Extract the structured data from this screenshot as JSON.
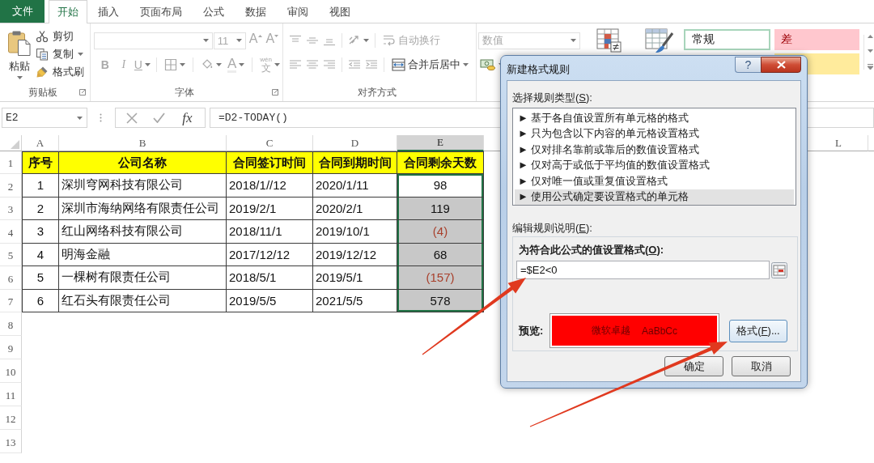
{
  "ribbon_tabs": [
    {
      "label": "文件",
      "kind": "file",
      "selected": false
    },
    {
      "label": "开始",
      "kind": "tab",
      "selected": true
    },
    {
      "label": "插入",
      "kind": "tab",
      "selected": false
    },
    {
      "label": "页面布局",
      "kind": "tab",
      "selected": false
    },
    {
      "label": "公式",
      "kind": "tab",
      "selected": false
    },
    {
      "label": "数据",
      "kind": "tab",
      "selected": false
    },
    {
      "label": "审阅",
      "kind": "tab",
      "selected": false
    },
    {
      "label": "视图",
      "kind": "tab",
      "selected": false
    }
  ],
  "clipboard_group": {
    "label": "剪贴板",
    "paste": "粘贴",
    "commands": [
      {
        "kind": "cut",
        "label": "剪切",
        "dropdown": false
      },
      {
        "kind": "copy",
        "label": "复制",
        "dropdown": true
      },
      {
        "kind": "painter",
        "label": "格式刷",
        "dropdown": false
      }
    ]
  },
  "font_group": {
    "label": "字体",
    "disabled": true,
    "font_size": "11",
    "size_buttons": [
      {
        "kind": "grow",
        "label": "A"
      },
      {
        "kind": "shrink",
        "label": "A"
      }
    ],
    "style_buttons": [
      {
        "kind": "bold",
        "label": "B"
      },
      {
        "kind": "italic",
        "label": "I"
      },
      {
        "kind": "underline",
        "label": "U"
      }
    ],
    "font_color": "A",
    "phonetic": {
      "label": "文",
      "ruby": "wén"
    }
  },
  "alignment_group": {
    "label": "对齐方式",
    "disabled": true,
    "wrap_text": {
      "label": "自动换行",
      "disabled": true
    },
    "merge_center": {
      "label": "合并后居中",
      "disabled": false
    }
  },
  "number_group": {
    "format": "数值",
    "disabled": true
  },
  "cell_styles": [
    {
      "kind": "normal",
      "label": "常规"
    },
    {
      "kind": "bad",
      "label": "差"
    },
    {
      "kind": "neutral"
    }
  ],
  "formula_bar": {
    "name_box": "E2",
    "function_button": "fx",
    "formula": "=D2-TODAY()"
  },
  "sheet": {
    "columns": [
      {
        "label": "A",
        "selected": false
      },
      {
        "label": "B",
        "selected": false
      },
      {
        "label": "C",
        "selected": false
      },
      {
        "label": "D",
        "selected": false
      },
      {
        "label": "E",
        "selected": true
      }
    ],
    "far_columns": [
      {
        "label": "L",
        "selected": false
      }
    ],
    "row_numbers": [
      "1",
      "2",
      "3",
      "4",
      "5",
      "6",
      "7",
      "8",
      "9",
      "10",
      "11",
      "12",
      "13"
    ],
    "header": [
      "序号",
      "公司名称",
      "合同签订时间",
      "合同到期时间",
      "合同剩余天数"
    ],
    "rows": [
      {
        "cells": [
          "1",
          "深圳穹网科技有限公司",
          "2018/1//12",
          "2020/1/11"
        ],
        "remaining": {
          "text": "98",
          "selected": true,
          "active": true,
          "negative": false
        }
      },
      {
        "cells": [
          "2",
          "深圳市海纳网络有限责任公司",
          "2019/2/1",
          "2020/2/1"
        ],
        "remaining": {
          "text": "119",
          "selected": true,
          "active": false,
          "negative": false
        }
      },
      {
        "cells": [
          "3",
          "红山网络科技有限公司",
          "2018/11/1",
          "2019/10/1"
        ],
        "remaining": {
          "text": "(4)",
          "selected": true,
          "active": false,
          "negative": true
        }
      },
      {
        "cells": [
          "4",
          "明海金融",
          "2017/12/12",
          "2019/12/12"
        ],
        "remaining": {
          "text": "68",
          "selected": true,
          "active": false,
          "negative": false
        }
      },
      {
        "cells": [
          "5",
          "一棵树有限责任公司",
          "2018/5/1",
          "2019/5/1"
        ],
        "remaining": {
          "text": "(157)",
          "selected": true,
          "active": false,
          "negative": true
        }
      },
      {
        "cells": [
          "6",
          "红石头有限责任公司",
          "2019/5/5",
          "2021/5/5"
        ],
        "remaining": {
          "text": "578",
          "selected": true,
          "active": false,
          "negative": false
        }
      }
    ]
  },
  "dialog": {
    "title": "新建格式规则",
    "help_button": "?",
    "rule_type_label": {
      "before": "选择规则类型(",
      "key": "S",
      "after": "):"
    },
    "rule_types": [
      {
        "label": "► 基于各自值设置所有单元格的格式",
        "selected": false
      },
      {
        "label": "► 只为包含以下内容的单元格设置格式",
        "selected": false
      },
      {
        "label": "► 仅对排名靠前或靠后的数值设置格式",
        "selected": false
      },
      {
        "label": "► 仅对高于或低于平均值的数值设置格式",
        "selected": false
      },
      {
        "label": "► 仅对唯一值或重复值设置格式",
        "selected": false
      },
      {
        "label": "► 使用公式确定要设置格式的单元格",
        "selected": true
      }
    ],
    "description_label": {
      "before": "编辑规则说明(",
      "key": "E",
      "after": "):"
    },
    "formula_label": {
      "before": "为符合此公式的值设置格式(",
      "key": "O",
      "after": "):"
    },
    "formula": "=$E2<0",
    "preview_label": "预览:",
    "preview_text": [
      "微软卓越",
      "AaBbCc"
    ],
    "format_button": {
      "before": "格式(",
      "key": "F",
      "after": ")..."
    },
    "buttons": [
      "确定",
      "取消"
    ]
  }
}
